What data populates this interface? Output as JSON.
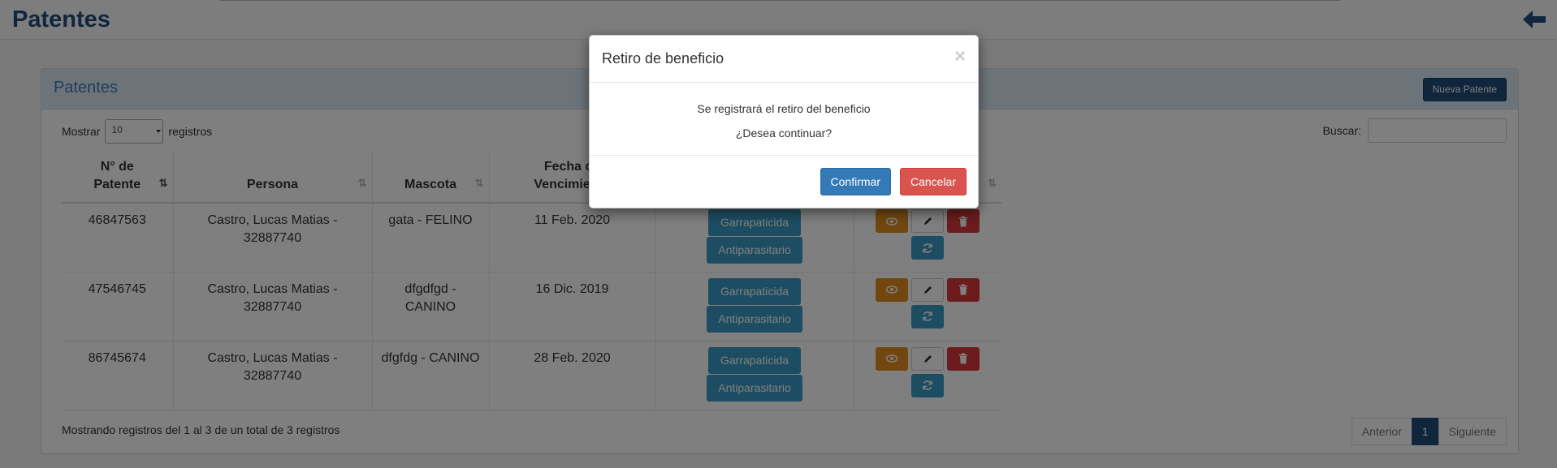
{
  "page": {
    "title": "Patentes"
  },
  "panel": {
    "title": "Patentes",
    "new_button": "Nueva Patente",
    "length_prefix": "Mostrar",
    "length_value": "10",
    "length_suffix": "registros",
    "search_label": "Buscar:",
    "search_value": ""
  },
  "table": {
    "headers": [
      {
        "line1": "N° de",
        "line2": "Patente"
      },
      {
        "line1": "",
        "line2": "Persona"
      },
      {
        "line1": "",
        "line2": "Mascota"
      },
      {
        "line1": "Fecha de",
        "line2": "Vencimiento"
      },
      {
        "line1": "",
        "line2": ""
      },
      {
        "line1": "",
        "line2": ""
      }
    ],
    "rows": [
      {
        "patente": "46847563",
        "persona1": "Castro, Lucas Matias -",
        "persona2": "32887740",
        "mascota1": "gata - FELINO",
        "mascota2": "",
        "fecha": "11 Feb. 2020",
        "ben1": "Garrapaticida",
        "ben2": "Antiparasitario"
      },
      {
        "patente": "47546745",
        "persona1": "Castro, Lucas Matias -",
        "persona2": "32887740",
        "mascota1": "dfgdfgd -",
        "mascota2": "CANINO",
        "fecha": "16 Dic. 2019",
        "ben1": "Garrapaticida",
        "ben2": "Antiparasitario"
      },
      {
        "patente": "86745674",
        "persona1": "Castro, Lucas Matias -",
        "persona2": "32887740",
        "mascota1": "dfgfdg - CANINO",
        "mascota2": "",
        "fecha": "28 Feb. 2020",
        "ben1": "Garrapaticida",
        "ben2": "Antiparasitario"
      }
    ]
  },
  "footer": {
    "info": "Mostrando registros del 1 al 3 de un total de 3 registros",
    "prev": "Anterior",
    "page": "1",
    "next": "Siguiente"
  },
  "modal": {
    "title": "Retiro de beneficio",
    "close": "×",
    "line1": "Se registrará el retiro del beneficio",
    "line2": "¿Desea continuar?",
    "confirm": "Confirmar",
    "cancel": "Cancelar"
  },
  "colors": {
    "brand": "#1f4d7a",
    "info": "#3a9ac4",
    "warning": "#e38f1e",
    "danger": "#d9383a",
    "primary": "#337ab7"
  },
  "icons": [
    "back-arrow-icon",
    "eye-icon",
    "pencil-icon",
    "trash-icon",
    "refresh-icon",
    "sort-icon"
  ]
}
